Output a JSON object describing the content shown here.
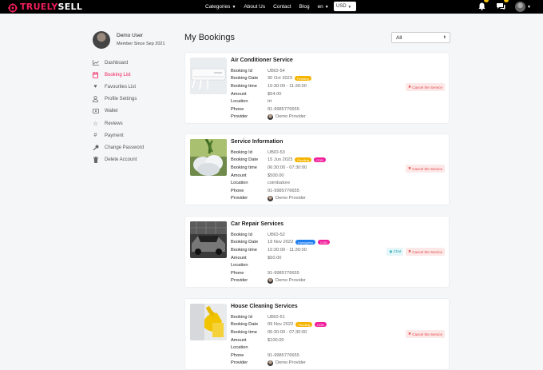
{
  "brand": {
    "name_part1": "TRUELY",
    "name_part2": "SELL"
  },
  "nav": {
    "categories": "Categories",
    "about": "About Us",
    "contact": "Contact",
    "blog": "Blog",
    "language": "en",
    "currency": "USD"
  },
  "icons": {
    "notification": "bell-icon",
    "chat": "chat-bubble-icon",
    "user": "user-avatar"
  },
  "colors": {
    "accent": "#f01e5a",
    "pending": "#f5b400",
    "cod": "#f01e9a",
    "inprogress": "#1e7ef0"
  },
  "sidebar": {
    "user_name": "Demo User",
    "member_since": "Member Since Sep 2021",
    "items": [
      {
        "label": "Dashboard",
        "icon": "chart-icon"
      },
      {
        "label": "Booking List",
        "icon": "calendar-icon",
        "active": true
      },
      {
        "label": "Favourites List",
        "icon": "heart-icon"
      },
      {
        "label": "Profile Settings",
        "icon": "user-icon"
      },
      {
        "label": "Wallet",
        "icon": "wallet-icon"
      },
      {
        "label": "Reviews",
        "icon": "star-icon"
      },
      {
        "label": "Payment",
        "icon": "hash-icon"
      },
      {
        "label": "Change Password",
        "icon": "key-icon"
      },
      {
        "label": "Delete Account",
        "icon": "trash-icon"
      }
    ]
  },
  "main": {
    "title": "My Bookings",
    "filter": "All"
  },
  "labels": {
    "booking_id": "Booking Id",
    "booking_date": "Booking Date",
    "booking_time": "Booking time",
    "amount": "Amount",
    "location": "Location",
    "phone": "Phone",
    "provider": "Provider",
    "cancel": "Cancel the Service",
    "chat": "Chat"
  },
  "bookings": [
    {
      "title": "Air Conditioner Service",
      "id": "UBID-54",
      "date": "30 Oct 2023",
      "status": "Pending",
      "payment": "",
      "time": "10:30:00 - 11:30:00",
      "amount": "$54.00",
      "location": "trt",
      "phone": "91-9985776655",
      "provider": "Demo Provider"
    },
    {
      "title": "Service Information",
      "id": "UBID-53",
      "date": "15 Jun 2023",
      "status": "Pending",
      "payment": "COD",
      "time": "06:30:00 - 07:30:00",
      "amount": "$500.00",
      "location": "coimbatore",
      "phone": "91-9985776655",
      "provider": "Demo Provider"
    },
    {
      "title": "Car Repair Services",
      "id": "UBID-52",
      "date": "19 Nov 2022",
      "status": "Inprogress",
      "payment": "COD",
      "time": "10:30:00 - 11:30:00",
      "amount": "$50.00",
      "location": "",
      "phone": "91-9985776655",
      "provider": "Demo Provider"
    },
    {
      "title": "House Cleaning Services",
      "id": "UBID-51",
      "date": "09 Nov 2022",
      "status": "Pending",
      "payment": "COD",
      "time": "06:30:00 - 07:30:00",
      "amount": "$100.00",
      "location": "",
      "phone": "91-9985776655",
      "provider": "Demo Provider"
    }
  ]
}
